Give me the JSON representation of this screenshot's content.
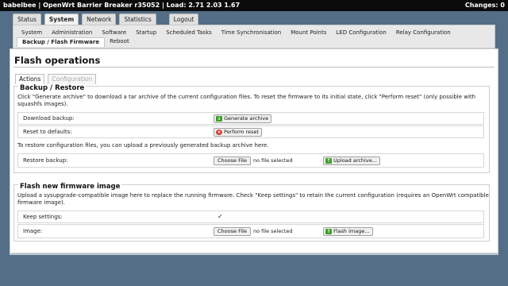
{
  "topbar": {
    "left": "babelbee | OpenWrt Barrier Breaker r35052 | Load: 2.71 2.03 1.67",
    "changes_label": "Changes:",
    "changes_count": "0"
  },
  "main_tabs": [
    "Status",
    "System",
    "Network",
    "Statistics",
    "Logout"
  ],
  "sub_nav_row1": [
    "System",
    "Administration",
    "Software",
    "Startup",
    "Scheduled Tasks",
    "Time Synchronisation",
    "Mount Points",
    "LED Configuration",
    "Relay Configuration"
  ],
  "sub_nav_row2": [
    "Backup / Flash Firmware",
    "Reboot"
  ],
  "page": {
    "title": "Flash operations",
    "tabs": [
      "Actions",
      "Configuration"
    ]
  },
  "backup": {
    "legend": "Backup / Restore",
    "desc_line1": "Click \"Generate archive\" to download a tar archive of the current configuration files. To reset the firmware to its initial state, click \"Perform reset\" (only possible with",
    "desc_line2": "squashfs images).",
    "download_label": "Download backup:",
    "generate_btn": "Generate archive",
    "reset_label": "Reset to defaults:",
    "reset_btn": "Perform reset",
    "restore_desc": "To restore configuration files, you can upload a previously generated backup archive here.",
    "restore_label": "Restore backup:",
    "choose_file": "Choose File",
    "no_file": "no file selected",
    "upload_btn": "Upload archive..."
  },
  "flash": {
    "legend": "Flash new firmware image",
    "desc_line1": "Upload a sysupgrade-compatible image here to replace the running firmware. Check \"Keep settings\" to retain the current configuration (requires an OpenWrt compatible",
    "desc_line2": "firmware image).",
    "keep_label": "Keep settings:",
    "keep_checked": "✓",
    "image_label": "Image:",
    "choose_file": "Choose File",
    "no_file": "no file selected",
    "flash_btn": "Flash image..."
  }
}
